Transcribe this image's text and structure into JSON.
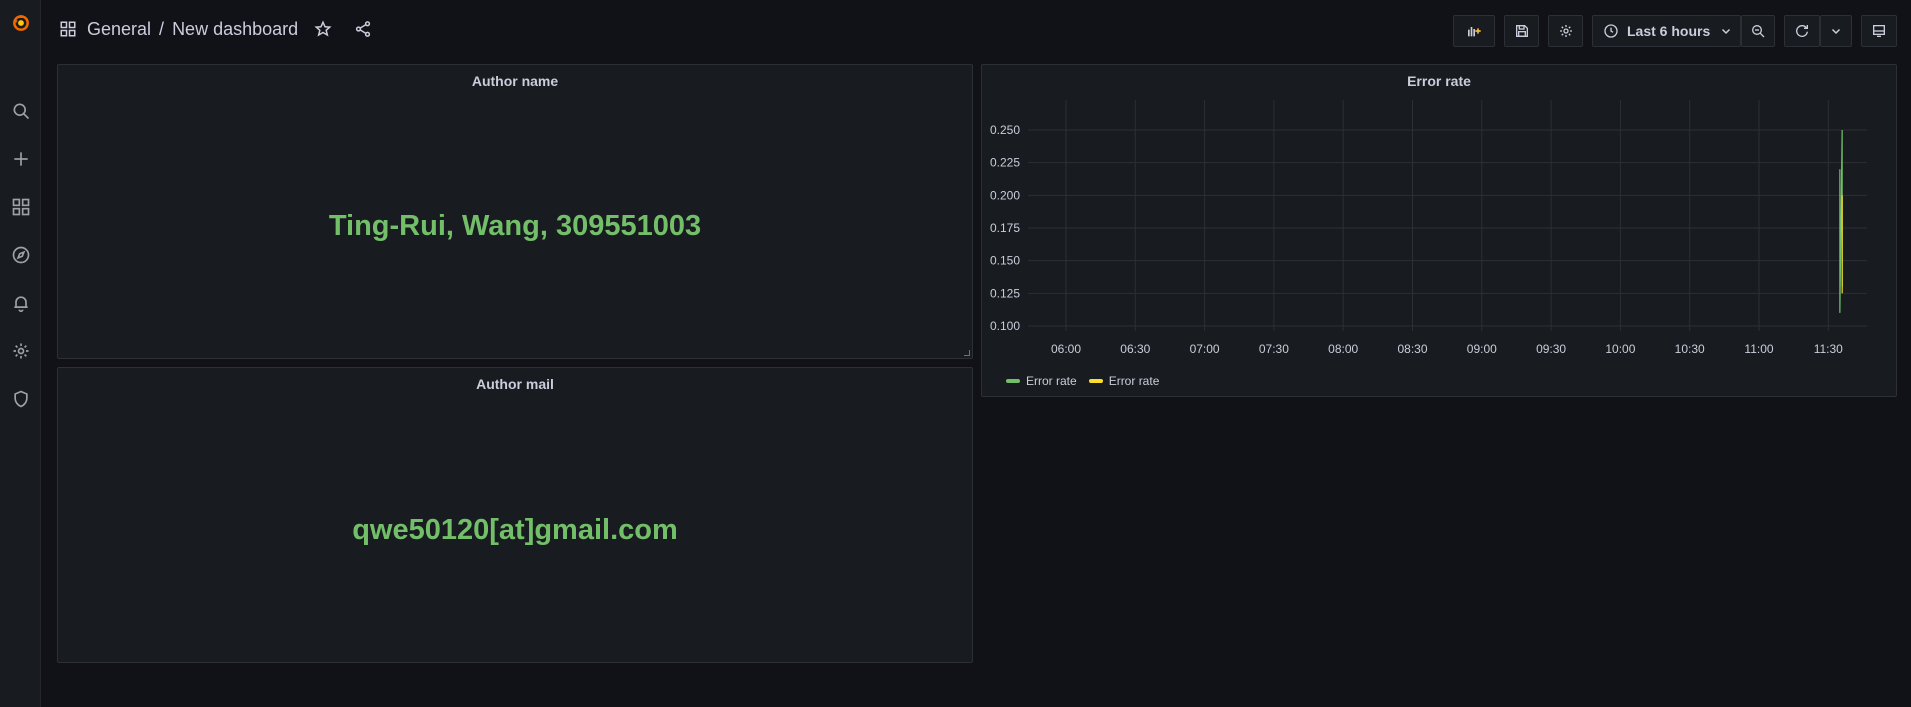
{
  "nav": {
    "breadcrumb_root": "General",
    "breadcrumb_sep": "/",
    "breadcrumb_page": "New dashboard",
    "time_range": "Last 6 hours"
  },
  "colors": {
    "accent_green": "#73bf69",
    "accent_yellow": "#fade2a",
    "logo_orange": "#f46800"
  },
  "sidebar": {
    "items": [
      {
        "icon": "grafana-logo-icon"
      },
      {
        "icon": "search-icon"
      },
      {
        "icon": "plus-icon"
      },
      {
        "icon": "dashboards-icon"
      },
      {
        "icon": "explore-icon"
      },
      {
        "icon": "alerting-bell-icon"
      },
      {
        "icon": "gear-icon"
      },
      {
        "icon": "shield-icon"
      }
    ]
  },
  "panels": {
    "author_name": {
      "title": "Author name",
      "value": "Ting-Rui, Wang, 309551003"
    },
    "author_mail": {
      "title": "Author mail",
      "value": "qwe50120[at]gmail.com"
    },
    "error_rate": {
      "title": "Error rate"
    }
  },
  "chart_data": {
    "type": "line",
    "title": "Error rate",
    "x_ticks": [
      "06:00",
      "06:30",
      "07:00",
      "07:30",
      "08:00",
      "08:30",
      "09:00",
      "09:30",
      "10:00",
      "10:30",
      "11:00",
      "11:30"
    ],
    "y_ticks": [
      "0.100",
      "0.125",
      "0.150",
      "0.175",
      "0.200",
      "0.225",
      "0.250"
    ],
    "ylim": [
      0.1,
      0.25
    ],
    "series": [
      {
        "name": "Error rate",
        "color": "#73bf69",
        "x": [
          "11:35",
          "11:35",
          "11:36",
          "11:36"
        ],
        "values": [
          0.22,
          0.11,
          0.25,
          0.13
        ]
      },
      {
        "name": "Error rate",
        "color": "#fade2a",
        "x": [
          "11:36",
          "11:36"
        ],
        "values": [
          0.2,
          0.125
        ]
      }
    ],
    "grid": true,
    "legend": "bottom-left"
  }
}
